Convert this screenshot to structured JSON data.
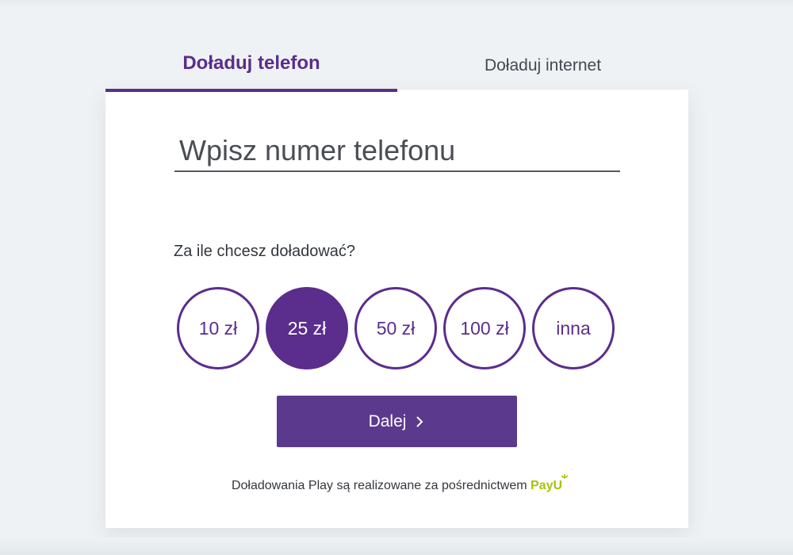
{
  "tabs": [
    {
      "label": "Doładuj telefon",
      "active": true
    },
    {
      "label": "Doładuj internet",
      "active": false
    }
  ],
  "phone_input": {
    "placeholder": "Wpisz numer telefonu",
    "value": ""
  },
  "amount_question": "Za ile chcesz doładować?",
  "amounts": [
    {
      "label": "10 zł",
      "selected": false
    },
    {
      "label": "25 zł",
      "selected": true
    },
    {
      "label": "50 zł",
      "selected": false
    },
    {
      "label": "100 zł",
      "selected": false
    },
    {
      "label": "inna",
      "selected": false
    }
  ],
  "next_button": {
    "label": "Dalej"
  },
  "footer": {
    "text": "Doładowania Play są realizowane za pośrednictwem",
    "brand": "PayU"
  },
  "colors": {
    "accent": "#5b2d8c",
    "button": "#5b3a8e",
    "payu": "#a6c307",
    "background": "#eef2f4"
  },
  "icons": {
    "next": "chevron-right-icon",
    "payu": "payu-logo"
  }
}
